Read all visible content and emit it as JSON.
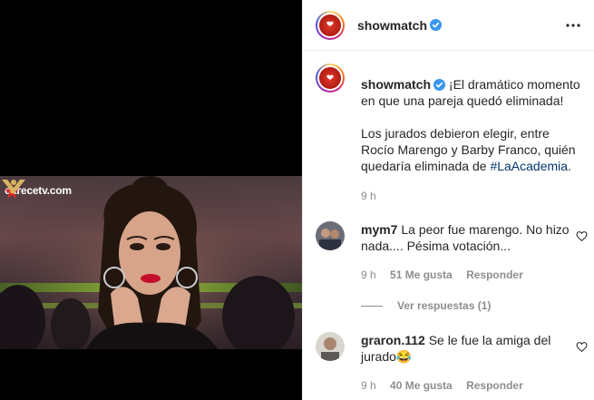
{
  "media": {
    "watermark": "eltrecetv.com"
  },
  "header": {
    "handle": "showmatch"
  },
  "caption": {
    "handle": "showmatch",
    "line1": "¡El dramático momento en que una pareja quedó eliminada!",
    "line2_before": "Los jurados debieron elegir, entre Rocío Marengo y Barby Franco, quién quedaría eliminada de ",
    "hashtag": "#LaAcademia",
    "line2_after": ".",
    "time": "9 h"
  },
  "comments": [
    {
      "user": "mym7",
      "text": "La peor fue marengo. No hizo nada.... Pésima votación...",
      "time": "9 h",
      "likes": "51 Me gusta",
      "reply": "Responder",
      "view_replies": "Ver respuestas (1)"
    },
    {
      "user": "graron.112",
      "text": "Se le fue la amiga del jurado",
      "emoji": "😂",
      "time": "9 h",
      "likes": "40 Me gusta",
      "reply": "Responder"
    }
  ],
  "colors": {
    "verified": "#3897f0",
    "hashtag": "#00376b",
    "muted": "#8e8e8e",
    "lips": "#c4102a"
  },
  "icons": {
    "verified": "verified-badge-icon",
    "more": "more-options-icon",
    "like": "heart-icon"
  }
}
